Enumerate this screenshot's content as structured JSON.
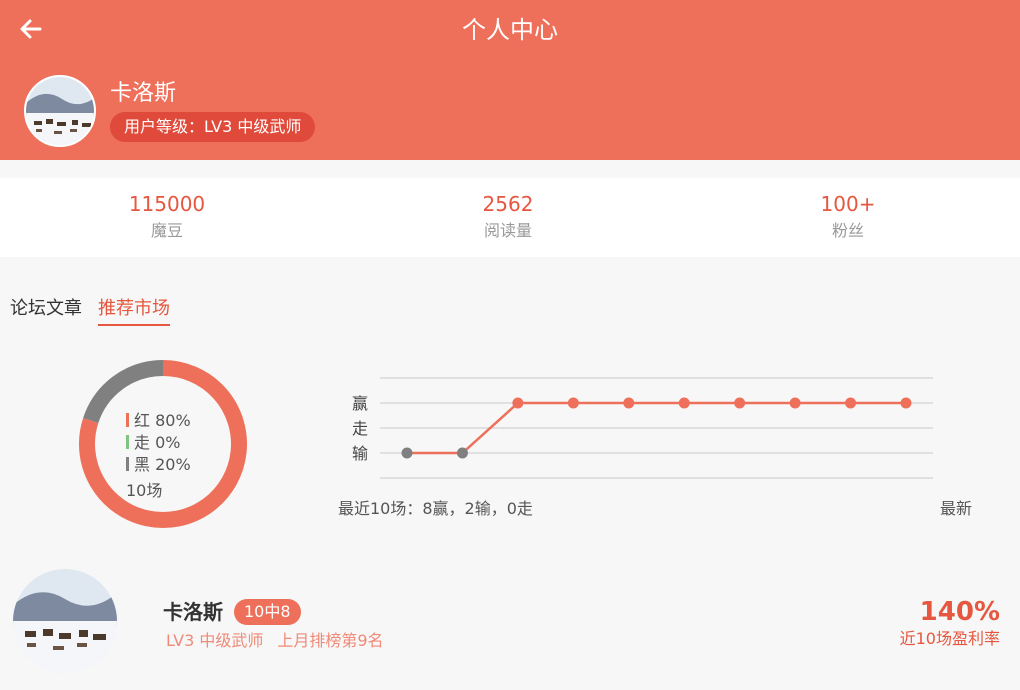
{
  "header": {
    "title": "个人中心"
  },
  "profile": {
    "name": "卡洛斯",
    "level_label": "用户等级：LV3 中级武师"
  },
  "stats": [
    {
      "value": "115000",
      "label": "魔豆"
    },
    {
      "value": "2562",
      "label": "阅读量"
    },
    {
      "value": "100+",
      "label": "粉丝"
    }
  ],
  "tabs": [
    {
      "label": "论坛文章",
      "active": false
    },
    {
      "label": "推荐市场",
      "active": true
    }
  ],
  "donut": {
    "legend": [
      {
        "text": "红 80%",
        "color": "#ee705a"
      },
      {
        "text": "走 0%",
        "color": "#7fc57f"
      },
      {
        "text": "黑 20%",
        "color": "#808080"
      }
    ],
    "total": "10场"
  },
  "chart_data": [
    {
      "type": "pie",
      "categories": [
        "红",
        "走",
        "黑"
      ],
      "values": [
        80,
        0,
        20
      ],
      "colors": [
        "#ee705a",
        "#7fc57f",
        "#808080"
      ]
    },
    {
      "type": "line",
      "yticks": [
        "赢",
        "走",
        "输"
      ],
      "series": [
        {
          "values": [
            "输",
            "输",
            "赢",
            "赢",
            "赢",
            "赢",
            "赢",
            "赢",
            "赢",
            "赢"
          ]
        }
      ],
      "colors": {
        "line": "#ee705a",
        "win_point": "#ee705a",
        "loss_point": "#808080"
      },
      "grid": true
    }
  ],
  "chart_caption": "最近10场：8赢，2输，0走",
  "chart_latest": "最新",
  "card": {
    "name": "卡洛斯",
    "badge": "10中8",
    "level": "LV3 中级武师",
    "rank": "上月排榜第9名",
    "profit": "140%",
    "profit_label": "近10场盈利率"
  },
  "colors": {
    "accent": "#ee705a",
    "accent_dark": "#e04a3a",
    "text_accent": "#e5573f"
  }
}
